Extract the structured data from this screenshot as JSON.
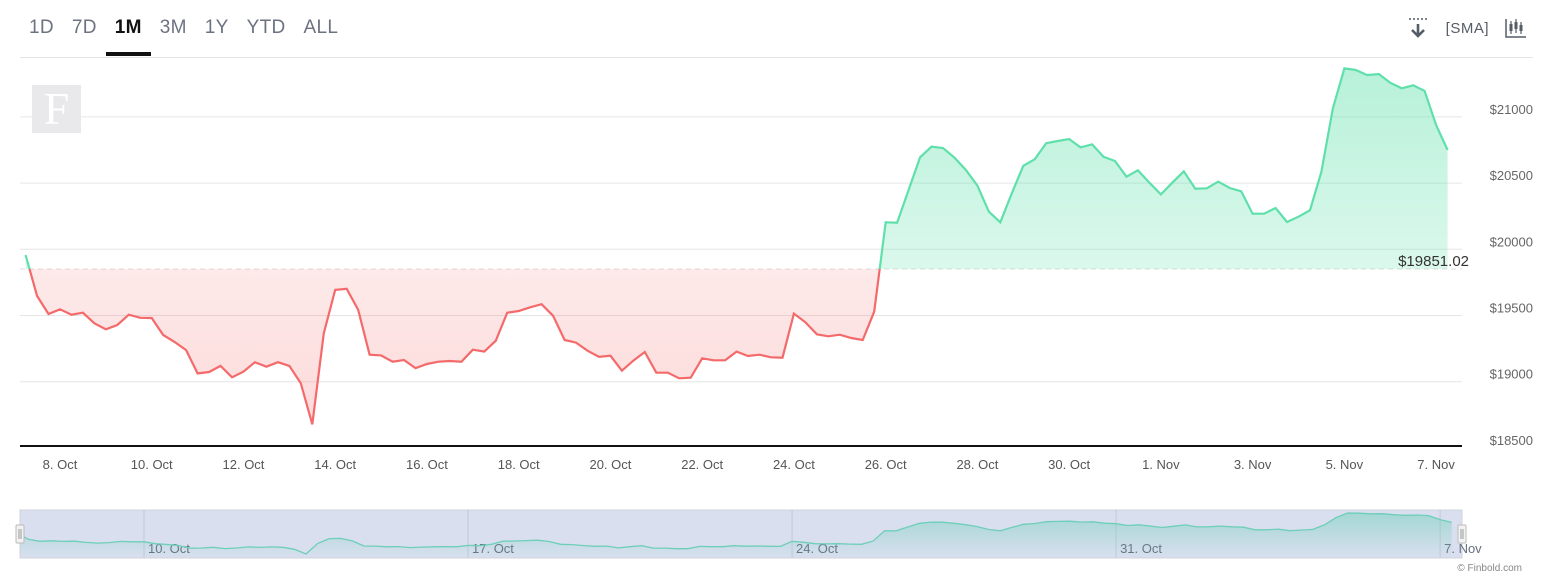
{
  "tabs": [
    {
      "label": "1D",
      "active": false
    },
    {
      "label": "7D",
      "active": false
    },
    {
      "label": "1M",
      "active": true
    },
    {
      "label": "3M",
      "active": false
    },
    {
      "label": "1Y",
      "active": false
    },
    {
      "label": "YTD",
      "active": false
    },
    {
      "label": "ALL",
      "active": false
    }
  ],
  "tools": {
    "download_icon": "download-icon",
    "sma_label": "[SMA]",
    "candlestick_icon": "candlestick-icon"
  },
  "logo_text": "F",
  "credit": "© Finbold.com",
  "colors": {
    "up": "#5fe0ab",
    "down": "#f46a6a",
    "navigator_bg": "#d9dfef",
    "navigator_line": "#6dcfb8"
  },
  "chart_data": {
    "type": "area",
    "baseline": {
      "value": 19851.02,
      "label": "$19851.02"
    },
    "ylim": [
      18500,
      21500
    ],
    "yticks": [
      18500,
      19000,
      19500,
      20000,
      20500,
      21000
    ],
    "ytick_labels": [
      "$18500",
      "$19000",
      "$19500",
      "$20000",
      "$20500",
      "$21000"
    ],
    "xtick_labels": [
      "8. Oct",
      "10. Oct",
      "12. Oct",
      "14. Oct",
      "16. Oct",
      "18. Oct",
      "20. Oct",
      "22. Oct",
      "24. Oct",
      "26. Oct",
      "28. Oct",
      "30. Oct",
      "1. Nov",
      "3. Nov",
      "5. Nov",
      "7. Nov"
    ],
    "xtick_dates": [
      "Oct 8",
      "Oct 10",
      "Oct 12",
      "Oct 14",
      "Oct 16",
      "Oct 18",
      "Oct 20",
      "Oct 22",
      "Oct 24",
      "Oct 26",
      "Oct 28",
      "Oct 30",
      "Nov 1",
      "Nov 3",
      "Nov 5",
      "Nov 7"
    ],
    "navigator_tick_labels": [
      "10. Oct",
      "17. Oct",
      "24. Oct",
      "31. Oct",
      "7. Nov"
    ],
    "navigator_tick_dates": [
      "Oct 10",
      "Oct 17",
      "Oct 24",
      "Oct 31",
      "Nov 7"
    ],
    "grid": true,
    "series": [
      {
        "x": [
          "Oct 7 06:00",
          "Oct 7 12:00",
          "Oct 7 18:00",
          "Oct 8 00:00",
          "Oct 8 06:00",
          "Oct 8 12:00",
          "Oct 8 18:00",
          "Oct 9 00:00",
          "Oct 9 06:00",
          "Oct 9 12:00",
          "Oct 9 18:00",
          "Oct 10 00:00",
          "Oct 10 06:00",
          "Oct 10 12:00",
          "Oct 10 18:00",
          "Oct 11 00:00",
          "Oct 11 06:00",
          "Oct 11 12:00",
          "Oct 11 18:00",
          "Oct 12 00:00",
          "Oct 12 06:00",
          "Oct 12 12:00",
          "Oct 12 18:00",
          "Oct 13 00:00",
          "Oct 13 06:00",
          "Oct 13 12:00",
          "Oct 13 18:00",
          "Oct 14 00:00",
          "Oct 14 06:00",
          "Oct 14 12:00",
          "Oct 14 18:00",
          "Oct 15 00:00",
          "Oct 15 06:00",
          "Oct 15 12:00",
          "Oct 15 18:00",
          "Oct 16 00:00",
          "Oct 16 06:00",
          "Oct 16 12:00",
          "Oct 16 18:00",
          "Oct 17 00:00",
          "Oct 17 06:00",
          "Oct 17 12:00",
          "Oct 17 18:00",
          "Oct 18 00:00",
          "Oct 18 06:00",
          "Oct 18 12:00",
          "Oct 18 18:00",
          "Oct 19 00:00",
          "Oct 19 06:00",
          "Oct 19 12:00",
          "Oct 19 18:00",
          "Oct 20 00:00",
          "Oct 20 06:00",
          "Oct 20 12:00",
          "Oct 20 18:00",
          "Oct 21 00:00",
          "Oct 21 06:00",
          "Oct 21 12:00",
          "Oct 21 18:00",
          "Oct 22 00:00",
          "Oct 22 06:00",
          "Oct 22 12:00",
          "Oct 22 18:00",
          "Oct 23 00:00",
          "Oct 23 06:00",
          "Oct 23 12:00",
          "Oct 23 18:00",
          "Oct 24 00:00",
          "Oct 24 06:00",
          "Oct 24 12:00",
          "Oct 24 18:00",
          "Oct 25 00:00",
          "Oct 25 06:00",
          "Oct 25 12:00",
          "Oct 25 18:00",
          "Oct 26 00:00",
          "Oct 26 06:00",
          "Oct 26 12:00",
          "Oct 26 18:00",
          "Oct 27 00:00",
          "Oct 27 06:00",
          "Oct 27 12:00",
          "Oct 27 18:00",
          "Oct 28 00:00",
          "Oct 28 06:00",
          "Oct 28 12:00",
          "Oct 28 18:00",
          "Oct 29 00:00",
          "Oct 29 06:00",
          "Oct 29 12:00",
          "Oct 29 18:00",
          "Oct 30 00:00",
          "Oct 30 06:00",
          "Oct 30 12:00",
          "Oct 30 18:00",
          "Oct 31 00:00",
          "Oct 31 06:00",
          "Oct 31 12:00",
          "Oct 31 18:00",
          "Nov 1 00:00",
          "Nov 1 06:00",
          "Nov 1 12:00",
          "Nov 1 18:00",
          "Nov 2 00:00",
          "Nov 2 06:00",
          "Nov 2 12:00",
          "Nov 2 18:00",
          "Nov 3 00:00",
          "Nov 3 06:00",
          "Nov 3 12:00",
          "Nov 3 18:00",
          "Nov 4 00:00",
          "Nov 4 06:00",
          "Nov 4 12:00",
          "Nov 4 18:00",
          "Nov 5 00:00",
          "Nov 5 06:00",
          "Nov 5 12:00",
          "Nov 5 18:00",
          "Nov 6 00:00",
          "Nov 6 06:00",
          "Nov 6 12:00",
          "Nov 6 18:00",
          "Nov 7 00:00",
          "Nov 7 06:00"
        ],
        "y": [
          19957,
          19647,
          19511,
          19547,
          19506,
          19521,
          19441,
          19396,
          19428,
          19506,
          19483,
          19481,
          19353,
          19300,
          19239,
          19063,
          19073,
          19119,
          19033,
          19076,
          19147,
          19113,
          19147,
          19119,
          18988,
          18678,
          19366,
          19693,
          19702,
          19542,
          19204,
          19199,
          19151,
          19164,
          19103,
          19134,
          19151,
          19156,
          19151,
          19242,
          19227,
          19310,
          19521,
          19534,
          19562,
          19585,
          19498,
          19315,
          19295,
          19234,
          19187,
          19196,
          19083,
          19159,
          19224,
          19068,
          19068,
          19026,
          19030,
          19177,
          19162,
          19162,
          19227,
          19194,
          19204,
          19184,
          19181,
          19514,
          19449,
          19358,
          19343,
          19355,
          19330,
          19315,
          19529,
          20204,
          20201,
          20448,
          20695,
          20775,
          20765,
          20692,
          20599,
          20480,
          20284,
          20204,
          20423,
          20631,
          20680,
          20801,
          20818,
          20833,
          20770,
          20793,
          20699,
          20667,
          20548,
          20597,
          20503,
          20415,
          20503,
          20589,
          20458,
          20461,
          20511,
          20463,
          20438,
          20269,
          20269,
          20312,
          20206,
          20246,
          20295,
          20586,
          21065,
          21367,
          21354,
          21316,
          21324,
          21258,
          21216,
          21239,
          21196,
          20939,
          20750
        ]
      }
    ]
  }
}
